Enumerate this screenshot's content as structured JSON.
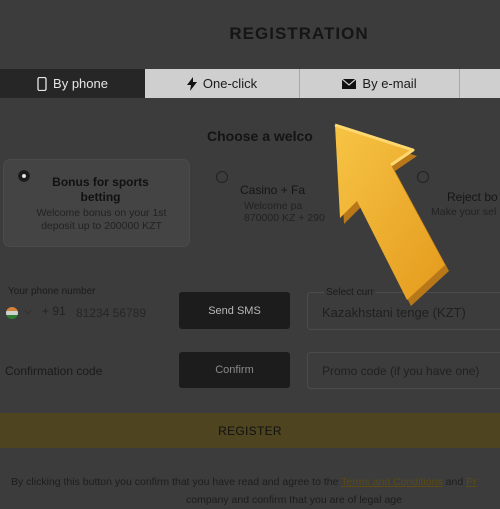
{
  "title": "REGISTRATION",
  "tabs": [
    {
      "label": "By phone",
      "icon": "phone-icon",
      "active": true
    },
    {
      "label": "One-click",
      "icon": "lightning-icon",
      "active": false
    },
    {
      "label": "By e-mail",
      "icon": "envelope-icon",
      "active": false
    }
  ],
  "bonus": {
    "heading": "Choose a welco",
    "sports": {
      "title_line1": "Bonus for sports",
      "title_line2": "betting",
      "desc_line1": "Welcome bonus on your 1st",
      "desc_line2": "deposit up to 200000 KZT"
    },
    "casino": {
      "title": "Casino + Fa",
      "desc_line1": "Welcome pa",
      "desc_line2": "870000 KZ + 290"
    },
    "reject": {
      "title": "Reject bo",
      "desc": "Make your sel"
    }
  },
  "phone": {
    "label": "Your phone number",
    "prefix": "+ 91",
    "placeholder": "81234 56789"
  },
  "send_sms": "Send SMS",
  "currency": {
    "label": "Select curr",
    "value": "Kazakhstani tenge (KZT)"
  },
  "confirmation_code": "Confirmation code",
  "confirm": "Confirm",
  "promo": "Promo code (if you have one)",
  "register": "REGISTER",
  "agreement": {
    "line1_pre": "By clicking this button you confirm that you have read and agree to the ",
    "terms_link": "Terms and Conditions",
    "line1_mid": " and ",
    "line1_post": "Pr",
    "line2": "company and confirm that you are of legal age"
  },
  "colors": {
    "overlay": "#3c3c3c",
    "arrow": "#f0b12d",
    "register": "#4e4420"
  }
}
